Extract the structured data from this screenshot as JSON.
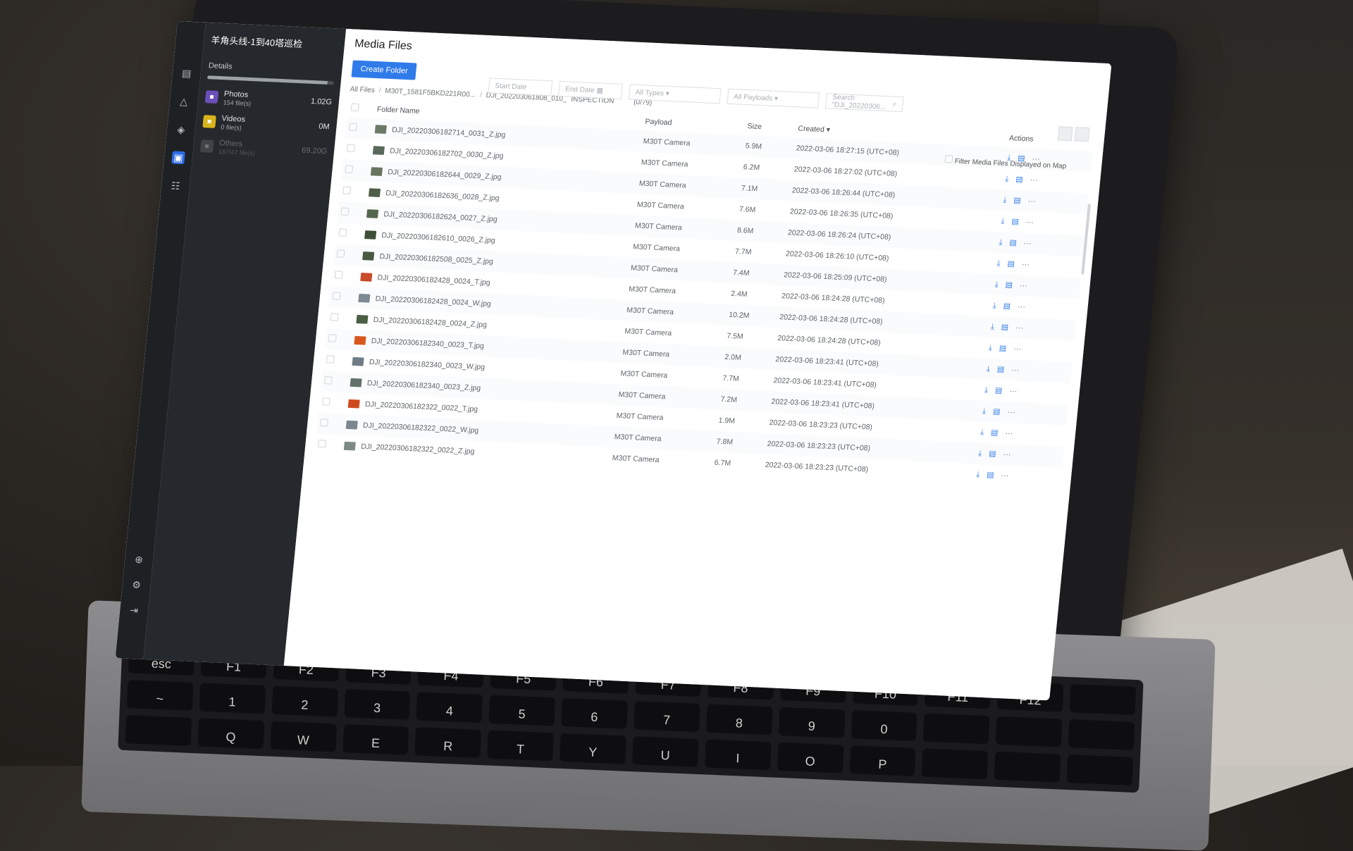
{
  "app": {
    "project_name": "羊角头线-1到40塔巡检"
  },
  "rail": {
    "icons": [
      "project-icon",
      "warning-icon",
      "layers-icon",
      "media-icon",
      "team-icon"
    ],
    "bottom_icons": [
      "globe-icon",
      "settings-icon",
      "logout-icon"
    ]
  },
  "panel": {
    "details_label": "Details",
    "storage_fill": 0.95,
    "stats": [
      {
        "name": "Photos",
        "count": "154 file(s)",
        "size": "1.02G",
        "color": "#6b4fb8",
        "icon": "photo-icon"
      },
      {
        "name": "Videos",
        "count": "0 file(s)",
        "size": "0M",
        "color": "#d7b419",
        "icon": "video-icon"
      },
      {
        "name": "Others",
        "count": "187/47 file(s)",
        "size": "69.20G",
        "color": "#777777",
        "icon": "other-icon"
      }
    ]
  },
  "main": {
    "title": "Media Files",
    "create_folder": "Create Folder",
    "start_date": "Start Date",
    "end_date": "End Date",
    "types": "All Types",
    "payloads": "All Payloads",
    "search_placeholder": "Search \"DJI_20220306...",
    "breadcrumb": [
      "All Files",
      "M30T_1581F5BKD221R00...",
      "DJI_202203061808_010_",
      "INSPECTION"
    ],
    "selection_count": "(0/79)",
    "filter_map": "Filter Media Files Displayed on Map",
    "columns": {
      "name": "Folder Name",
      "payload": "Payload",
      "size": "Size",
      "created": "Created",
      "actions": "Actions"
    },
    "rows": [
      {
        "name": "DJI_20220306182714_0031_Z.jpg",
        "payload": "M30T Camera",
        "size": "5.9M",
        "created": "2022-03-06 18:27:15 (UTC+08)",
        "thumb": "#6b7a66"
      },
      {
        "name": "DJI_20220306182702_0030_Z.jpg",
        "payload": "M30T Camera",
        "size": "6.2M",
        "created": "2022-03-06 18:27:02 (UTC+08)",
        "thumb": "#5a6a5a"
      },
      {
        "name": "DJI_20220306182644_0029_Z.jpg",
        "payload": "M30T Camera",
        "size": "7.1M",
        "created": "2022-03-06 18:26:44 (UTC+08)",
        "thumb": "#687460"
      },
      {
        "name": "DJI_20220306182636_0028_Z.jpg",
        "payload": "M30T Camera",
        "size": "7.6M",
        "created": "2022-03-06 18:26:35 (UTC+08)",
        "thumb": "#4f5e48"
      },
      {
        "name": "DJI_20220306182624_0027_Z.jpg",
        "payload": "M30T Camera",
        "size": "8.6M",
        "created": "2022-03-06 18:26:24 (UTC+08)",
        "thumb": "#54664c"
      },
      {
        "name": "DJI_20220306182610_0026_Z.jpg",
        "payload": "M30T Camera",
        "size": "7.7M",
        "created": "2022-03-06 18:26:10 (UTC+08)",
        "thumb": "#3f5039"
      },
      {
        "name": "DJI_20220306182508_0025_Z.jpg",
        "payload": "M30T Camera",
        "size": "7.4M",
        "created": "2022-03-06 18:25:09 (UTC+08)",
        "thumb": "#4a5a40"
      },
      {
        "name": "DJI_20220306182428_0024_T.jpg",
        "payload": "M30T Camera",
        "size": "2.4M",
        "created": "2022-03-06 18:24:28 (UTC+08)",
        "thumb": "#c94a2a"
      },
      {
        "name": "DJI_20220306182428_0024_W.jpg",
        "payload": "M30T Camera",
        "size": "10.2M",
        "created": "2022-03-06 18:24:28 (UTC+08)",
        "thumb": "#7d8a94"
      },
      {
        "name": "DJI_20220306182428_0024_Z.jpg",
        "payload": "M30T Camera",
        "size": "7.5M",
        "created": "2022-03-06 18:24:28 (UTC+08)",
        "thumb": "#4c5e44"
      },
      {
        "name": "DJI_20220306182340_0023_T.jpg",
        "payload": "M30T Camera",
        "size": "2.0M",
        "created": "2022-03-06 18:23:41 (UTC+08)",
        "thumb": "#d8571f"
      },
      {
        "name": "DJI_20220306182340_0023_W.jpg",
        "payload": "M30T Camera",
        "size": "7.7M",
        "created": "2022-03-06 18:23:41 (UTC+08)",
        "thumb": "#6f7c86"
      },
      {
        "name": "DJI_20220306182340_0023_Z.jpg",
        "payload": "M30T Camera",
        "size": "7.2M",
        "created": "2022-03-06 18:23:41 (UTC+08)",
        "thumb": "#62726a"
      },
      {
        "name": "DJI_20220306182322_0022_T.jpg",
        "payload": "M30T Camera",
        "size": "1.9M",
        "created": "2022-03-06 18:23:23 (UTC+08)",
        "thumb": "#cf4a1f"
      },
      {
        "name": "DJI_20220306182322_0022_W.jpg",
        "payload": "M30T Camera",
        "size": "7.8M",
        "created": "2022-03-06 18:23:23 (UTC+08)",
        "thumb": "#7a8690"
      },
      {
        "name": "DJI_20220306182322_0022_Z.jpg",
        "payload": "M30T Camera",
        "size": "6.7M",
        "created": "2022-03-06 18:23:23 (UTC+08)",
        "thumb": "#7d8a84"
      }
    ]
  },
  "keyboard": {
    "keys": [
      "esc",
      "F1",
      "F2",
      "F3",
      "F4",
      "F5",
      "F6",
      "F7",
      "F8",
      "F9",
      "F10",
      "F11",
      "F12",
      "",
      "~",
      "1",
      "2",
      "3",
      "4",
      "5",
      "6",
      "7",
      "8",
      "9",
      "0",
      "",
      "",
      "",
      "",
      "Q",
      "W",
      "E",
      "R",
      "T",
      "Y",
      "U",
      "I",
      "O",
      "P",
      "",
      "",
      ""
    ]
  }
}
